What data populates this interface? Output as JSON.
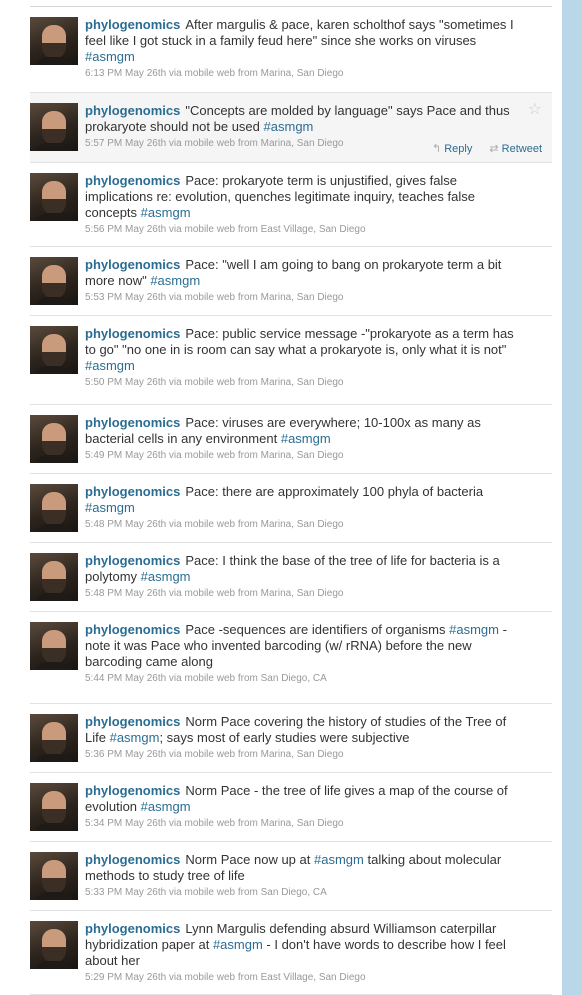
{
  "tweets": [
    {
      "user": "phylogenomics",
      "text": "After margulis & pace, karen scholthof says \"sometimes I feel like I got stuck in a family feud here\" since she works on viruses",
      "tag": "#asmgm",
      "after": "",
      "meta": "6:13 PM May 26th via mobile web from Marina, San Diego"
    },
    {
      "user": "phylogenomics",
      "text": "\"Concepts are molded by language\" says Pace and thus prokaryote should not be used",
      "tag": "#asmgm",
      "after": "",
      "meta": "5:57 PM May 26th via mobile web from Marina, San Diego",
      "highlight": true,
      "reply": "Reply",
      "retweet": "Retweet"
    },
    {
      "user": "phylogenomics",
      "text": "Pace: prokaryote term is unjustified, gives false implications re: evolution, quenches legitimate inquiry, teaches false concepts",
      "tag": "#asmgm",
      "after": "",
      "meta": "5:56 PM May 26th via mobile web from East Village, San Diego"
    },
    {
      "user": "phylogenomics",
      "text": "Pace: \"well I am going to bang on prokaryote term a bit more now\"",
      "tag": "#asmgm",
      "after": "",
      "meta": "5:53 PM May 26th via mobile web from Marina, San Diego"
    },
    {
      "user": "phylogenomics",
      "text": "Pace: public service message -\"prokaryote as a term has to go\" \"no one in is room can say what a prokaryote is, only what it is not\"",
      "tag": "#asmgm",
      "after": "",
      "meta": "5:50 PM May 26th via mobile web from Marina, San Diego"
    },
    {
      "user": "phylogenomics",
      "text": "Pace: viruses are everywhere; 10-100x as many as bacterial cells in any environment",
      "tag": "#asmgm",
      "after": "",
      "meta": "5:49 PM May 26th via mobile web from Marina, San Diego"
    },
    {
      "user": "phylogenomics",
      "text": "Pace: there are approximately 100 phyla of bacteria",
      "tag": "#asmgm",
      "after": "",
      "meta": "5:48 PM May 26th via mobile web from Marina, San Diego"
    },
    {
      "user": "phylogenomics",
      "text": "Pace: I think the base of the tree of life for bacteria is a polytomy",
      "tag": "#asmgm",
      "after": "",
      "meta": "5:48 PM May 26th via mobile web from Marina, San Diego"
    },
    {
      "user": "phylogenomics",
      "text": "Pace -sequences are identifiers of organisms",
      "tag": "#asmgm",
      "after": " - note it was Pace who invented barcoding (w/ rRNA) before the new barcoding came along",
      "meta": "5:44 PM May 26th via mobile web from San Diego, CA"
    },
    {
      "user": "phylogenomics",
      "text": "Norm Pace covering the history of studies of the Tree of Life",
      "tag": "#asmgm",
      "after": "; says most of early studies were subjective",
      "meta": "5:36 PM May 26th via mobile web from Marina, San Diego"
    },
    {
      "user": "phylogenomics",
      "text": "Norm Pace - the tree of life gives a map of the course of evolution",
      "tag": "#asmgm",
      "after": "",
      "meta": "5:34 PM May 26th via mobile web from Marina, San Diego"
    },
    {
      "user": "phylogenomics",
      "text": "Norm Pace now up at",
      "tag": "#asmgm",
      "after": " talking about molecular methods to study tree of life",
      "meta": "5:33 PM May 26th via mobile web from San Diego, CA"
    },
    {
      "user": "phylogenomics",
      "text": "Lynn Margulis defending absurd Williamson caterpillar hybridization paper at",
      "tag": "#asmgm",
      "after": " - I don't have words to describe how I feel about her",
      "meta": "5:29 PM May 26th via mobile web from East Village, San Diego"
    }
  ],
  "icons": {
    "star": "favorite-star-icon",
    "reply": "reply-arrow-icon",
    "retweet": "retweet-icon"
  },
  "colors": {
    "link": "#2b6d92",
    "meta": "#999999",
    "background": "#c0deed"
  }
}
